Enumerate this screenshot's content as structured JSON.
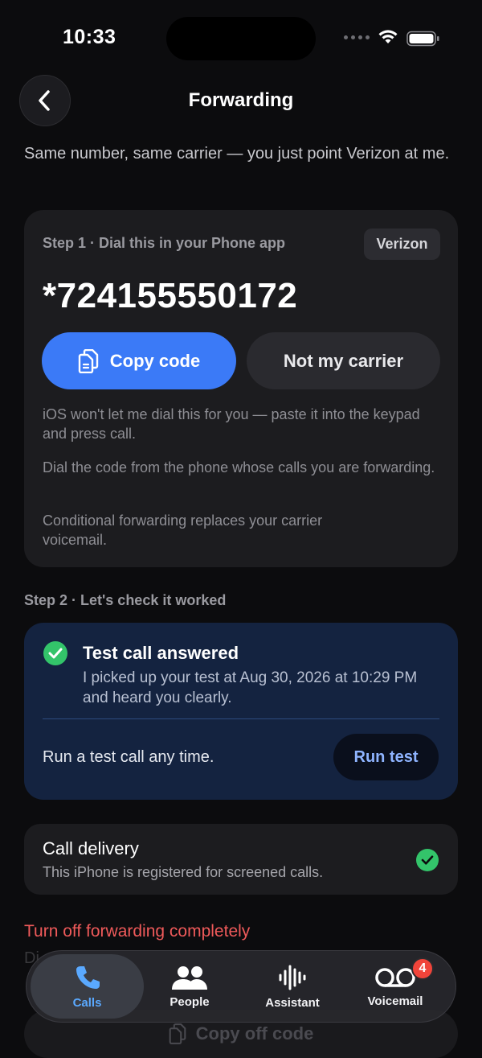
{
  "status": {
    "time": "10:33"
  },
  "nav": {
    "title": "Forwarding"
  },
  "intro": "Same number, same carrier — you just point Verizon at me.",
  "step1": {
    "label": "Step 1 · Dial this in your Phone app",
    "carrier": "Verizon",
    "code": "*724155550172",
    "copy_label": "Copy code",
    "not_my_carrier_label": "Not my carrier",
    "notes": [
      "iOS won't let me dial this for you — paste it into the keypad and press call.",
      "Dial the code from the phone whose calls you are forwarding.",
      "Conditional forwarding replaces your carrier voicemail."
    ]
  },
  "step2": {
    "label": "Step 2 · Let's check it worked",
    "result_title": "Test call answered",
    "result_body": "I picked up your test at Aug 30, 2026 at 10:29 PM and heard you clearly.",
    "run_text": "Run a test call any time.",
    "run_label": "Run test"
  },
  "delivery": {
    "title": "Call delivery",
    "body": "This iPhone is registered for screened calls."
  },
  "turnoff": {
    "label": "Turn off forwarding completely",
    "copy_off_label": "Copy off code"
  },
  "tabs": [
    {
      "label": "Calls",
      "icon": "phone-icon",
      "active": true
    },
    {
      "label": "People",
      "icon": "people-icon"
    },
    {
      "label": "Assistant",
      "icon": "waveform-icon"
    },
    {
      "label": "Voicemail",
      "icon": "voicemail-icon",
      "badge": "4"
    }
  ],
  "colors": {
    "accent": "#3b7af7",
    "success": "#33c46a",
    "danger": "#ef5a5a",
    "badge": "#f0443a"
  }
}
